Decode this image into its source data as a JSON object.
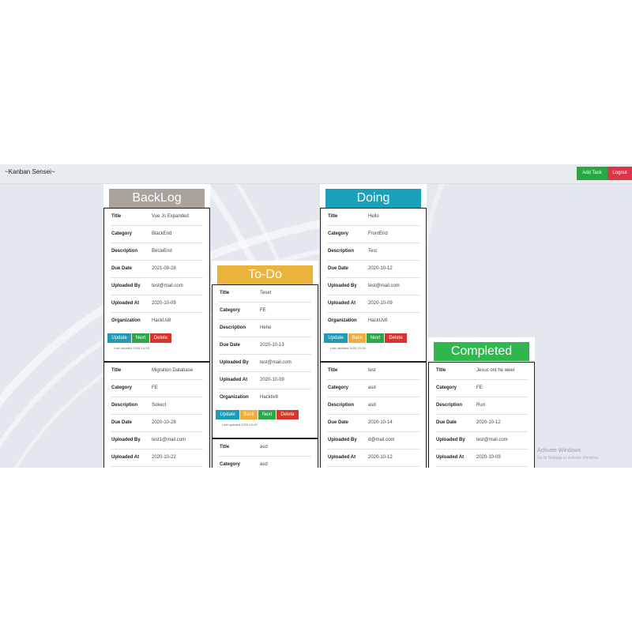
{
  "navbar": {
    "brand": "~Kanban Sensei~",
    "add_task": "Add Task",
    "logout": "Logout"
  },
  "colors": {
    "backlog": "#aaa39b",
    "todo": "#eab43c",
    "doing": "#1aa1ba",
    "completed": "#2fb84d",
    "update": "#1e9cb6",
    "back": "#f0ad3c",
    "next": "#2aa84a",
    "delete": "#d9342b"
  },
  "labels": {
    "title": "Title",
    "category": "Category",
    "description": "Description",
    "due_date": "Due Date",
    "uploaded_by": "Uploaded By",
    "uploaded_at": "Uploaded At",
    "organization": "Organization"
  },
  "buttons": {
    "update": "Update",
    "back": "Back",
    "next": "Next",
    "delete": "Delete"
  },
  "columns": [
    {
      "name": "BackLog",
      "cards": [
        {
          "title": "Vue Js Expanded",
          "category": "BlackEnd",
          "description": "BeUeEnd",
          "due_date": "2021-09-28",
          "uploaded_by": "test@mail.com",
          "uploaded_at": "2020-10-09",
          "organization": "HackUv8",
          "updated": "Last updated 2020-10-09"
        },
        {
          "title": "Migration Database",
          "category": "FE",
          "description": "Sokect",
          "due_date": "2020-10-28",
          "uploaded_by": "test1@mail.com",
          "uploaded_at": "2020-10-22"
        }
      ]
    },
    {
      "name": "To-Do",
      "cards": [
        {
          "title": "Teset",
          "category": "FE",
          "description": "Hehe",
          "due_date": "2020-10-13",
          "uploaded_by": "test@mail.com",
          "uploaded_at": "2020-10-09",
          "organization": "Hacktiv8",
          "updated": "Last updated 2020-10-09"
        },
        {
          "title": "asd",
          "category": "asd"
        }
      ]
    },
    {
      "name": "Doing",
      "cards": [
        {
          "title": "Hello",
          "category": "FrontEnd",
          "description": "Test",
          "due_date": "2020-10-12",
          "uploaded_by": "test@mail.com",
          "uploaded_at": "2020-10-09",
          "organization": "HackUv8",
          "updated": "Last updated 2020-10-09"
        },
        {
          "title": "test",
          "category": "asd",
          "description": "asd",
          "due_date": "2020-10-14",
          "uploaded_by": "d@mail.com",
          "uploaded_at": "2020-10-12"
        }
      ]
    },
    {
      "name": "Completed",
      "cards": [
        {
          "title": "Jesus ont he weel",
          "category": "FE",
          "description": "Rurr",
          "due_date": "2020-10-12",
          "uploaded_by": "test@mail.com",
          "uploaded_at": "2020-10-09"
        }
      ]
    }
  ],
  "watermark": {
    "line1": "Activate Windows",
    "line2": "Go to Settings to activate Windows."
  }
}
